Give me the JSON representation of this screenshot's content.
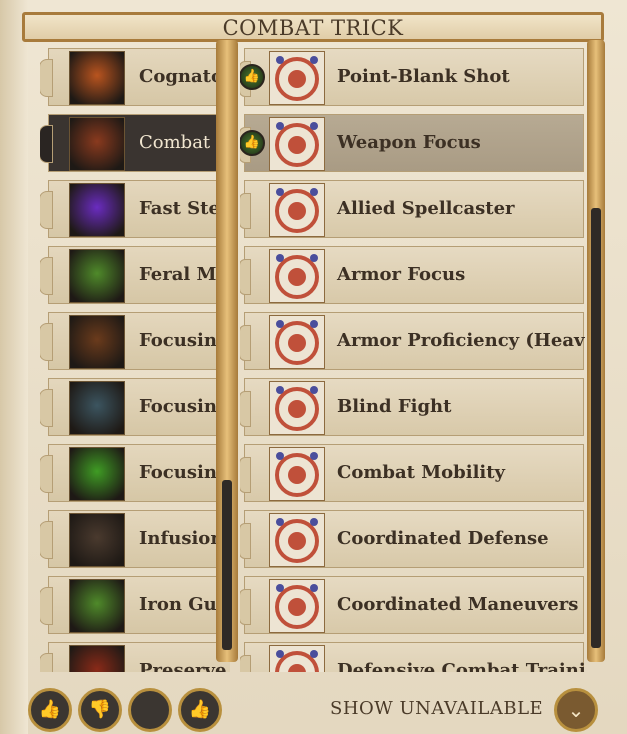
{
  "header": {
    "title": "COMBAT TRICK"
  },
  "left_list": {
    "items": [
      {
        "label": "Cognatogen",
        "icon": "flask-icon",
        "color": "#b9541f",
        "selected": false
      },
      {
        "label": "Combat Trick",
        "icon": "fist-icon",
        "color": "#8a3a1e",
        "selected": true
      },
      {
        "label": "Fast Stealth",
        "icon": "shadow-run-icon",
        "color": "#6a2cc0",
        "selected": false
      },
      {
        "label": "Feral Mutagen",
        "icon": "claws-icon",
        "color": "#4f8a2a",
        "selected": false
      },
      {
        "label": "Focusing Attack",
        "icon": "face-icon",
        "color": "#6b3b1c",
        "selected": false
      },
      {
        "label": "Focusing Attack",
        "icon": "ghost-figure-icon",
        "color": "#3c5560",
        "selected": false
      },
      {
        "label": "Focusing Attack",
        "icon": "green-face-icon",
        "color": "#3f9c24",
        "selected": false
      },
      {
        "label": "Infusion",
        "icon": "rune-icon",
        "color": "#4a3a2e",
        "selected": false
      },
      {
        "label": "Iron Guts",
        "icon": "claws-icon",
        "color": "#4f8a2a",
        "selected": false
      },
      {
        "label": "Preserve Organs",
        "icon": "swirl-icon",
        "color": "#8a2a18",
        "selected": false
      }
    ]
  },
  "right_list": {
    "items": [
      {
        "label": "Point-Blank Shot",
        "icon": "bow-icon",
        "recommended": true,
        "selected": false
      },
      {
        "label": "Weapon Focus",
        "icon": "sword-icon",
        "recommended": true,
        "selected": true
      },
      {
        "label": "Allied Spellcaster",
        "icon": "party-icon",
        "recommended": false,
        "selected": false
      },
      {
        "label": "Armor Focus",
        "icon": "armor-icon",
        "recommended": false,
        "selected": false
      },
      {
        "label": "Armor Proficiency (Heavy Armor)",
        "icon": "armor-icon",
        "recommended": false,
        "selected": false
      },
      {
        "label": "Blind Fight",
        "icon": "crossed-swords-icon",
        "recommended": false,
        "selected": false
      },
      {
        "label": "Combat Mobility",
        "icon": "shield-icon",
        "recommended": false,
        "selected": false
      },
      {
        "label": "Coordinated Defense",
        "icon": "party-icon",
        "recommended": false,
        "selected": false
      },
      {
        "label": "Coordinated Maneuvers",
        "icon": "party-icon",
        "recommended": false,
        "selected": false
      },
      {
        "label": "Defensive Combat Training",
        "icon": "shield-icon",
        "recommended": false,
        "selected": false
      }
    ]
  },
  "footer": {
    "filters": [
      {
        "name": "recommended-not-recommended-filter",
        "glyph": "👍"
      },
      {
        "name": "not-recommended-filter",
        "glyph": "👎"
      },
      {
        "name": "neutral-filter",
        "glyph": ""
      },
      {
        "name": "recommended-filter",
        "glyph": "👍"
      }
    ],
    "show_unavailable_label": "SHOW UNAVAILABLE",
    "toggle_glyph": "⌄"
  },
  "colors": {
    "accent_gold": "#b8903e",
    "icon_red": "#c0503a",
    "icon_blue": "#4a4e9c"
  }
}
